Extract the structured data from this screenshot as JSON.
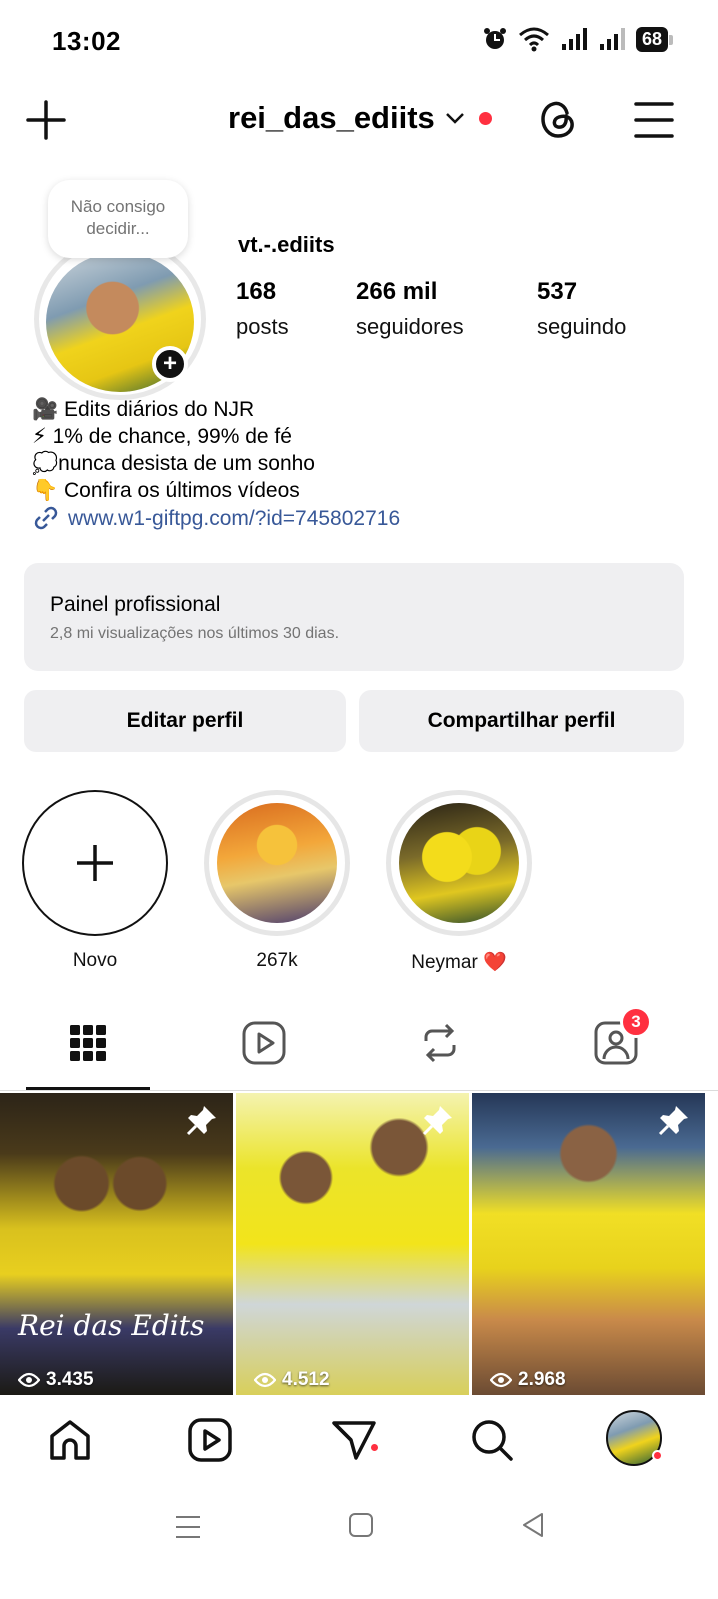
{
  "status_bar": {
    "time": "13:02",
    "battery": "68"
  },
  "header": {
    "username": "rei_das_ediits"
  },
  "profile": {
    "note": "Não consigo decidir...",
    "display_name": "vt.-.ediits",
    "stats": [
      {
        "value": "168",
        "label": "posts"
      },
      {
        "value": "266 mil",
        "label": "seguidores"
      },
      {
        "value": "537",
        "label": "seguindo"
      }
    ],
    "bio": [
      "🎥 Edits diários do NJR",
      "⚡ 1% de chance, 99% de fé",
      "💭nunca desista de um sonho",
      "👇 Confira os últimos vídeos"
    ],
    "link": "www.w1-giftpg.com/?id=745802716"
  },
  "dashboard": {
    "title": "Painel profissional",
    "subtitle": "2,8 mi visualizações nos últimos 30 dias."
  },
  "buttons": {
    "edit": "Editar perfil",
    "share": "Compartilhar perfil"
  },
  "highlights": [
    {
      "label": "Novo",
      "icon": "plus-icon"
    },
    {
      "label": "267k"
    },
    {
      "label": "Neymar ❤️"
    }
  ],
  "tabs": {
    "tagged_badge": "3"
  },
  "grid": [
    {
      "views": "3.435",
      "caption": "Rei das Edits"
    },
    {
      "views": "4.512"
    },
    {
      "views": "2.968"
    }
  ],
  "colors": {
    "accent_red": "#ff3040",
    "link": "#385898",
    "panel_bg": "#efeff1"
  }
}
